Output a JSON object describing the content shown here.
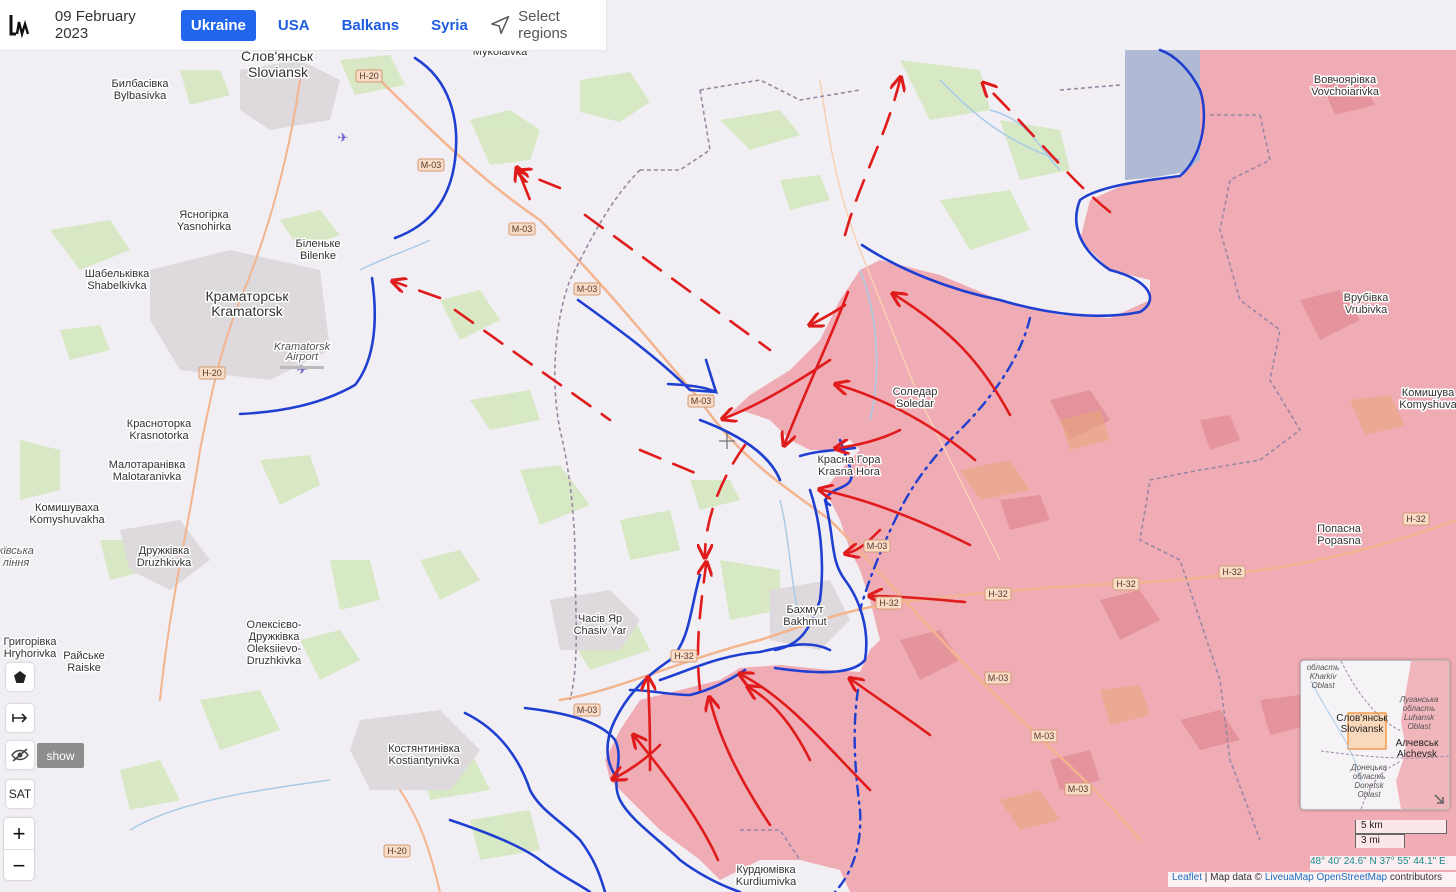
{
  "header": {
    "date": "09 February 2023",
    "tabs": [
      {
        "label": "Ukraine",
        "active": true
      },
      {
        "label": "USA",
        "active": false
      },
      {
        "label": "Balkans",
        "active": false
      },
      {
        "label": "Syria",
        "active": false
      }
    ],
    "select_regions": "Select regions"
  },
  "colors": {
    "occupied": "#f0a6ae",
    "contested": "#a8b4d2",
    "ukraine_arrows": "#1f3fd1",
    "russia_arrows": "#e01b1b",
    "background": "#f2eff4"
  },
  "places": [
    {
      "id": "mykolaivka",
      "text": "Mykolaivka"
    },
    {
      "id": "sloviansk-uk",
      "text": "Слов'янськ"
    },
    {
      "id": "sloviansk",
      "text": "Sloviansk"
    },
    {
      "id": "bylbasivka-uk",
      "text": "Билбасівка"
    },
    {
      "id": "bylbasivka",
      "text": "Bylbasivka"
    },
    {
      "id": "yasnohirka-uk",
      "text": "Ясногірка"
    },
    {
      "id": "yasnohirka",
      "text": "Yasnohirka"
    },
    {
      "id": "bilenke-uk",
      "text": "Біленьке"
    },
    {
      "id": "bilenke",
      "text": "Bilenke"
    },
    {
      "id": "shabelkivka-uk",
      "text": "Шабельківка"
    },
    {
      "id": "shabelkivka",
      "text": "Shabelkivka"
    },
    {
      "id": "kramatorsk-uk",
      "text": "Краматорськ"
    },
    {
      "id": "kramatorsk",
      "text": "Kramatorsk"
    },
    {
      "id": "kramatorsk-airport-1",
      "text": "Kramatorsk"
    },
    {
      "id": "kramatorsk-airport-2",
      "text": "Airport"
    },
    {
      "id": "krasnotorka-uk",
      "text": "Красноторка"
    },
    {
      "id": "krasnotorka",
      "text": "Krasnotorka"
    },
    {
      "id": "malotaranivka-uk",
      "text": "Малотаранівка"
    },
    {
      "id": "malotaranivka",
      "text": "Malotaranivka"
    },
    {
      "id": "komyshuvakha-uk",
      "text": "Комишуваха"
    },
    {
      "id": "komyshuvakha",
      "text": "Komyshuvakha"
    },
    {
      "id": "druzhkivka-uk",
      "text": "Дружківка"
    },
    {
      "id": "druzhkivka",
      "text": "Druzhkivka"
    },
    {
      "id": "oleksiievo-uk",
      "text": "Олексієво-"
    },
    {
      "id": "oleksiievo-uk2",
      "text": "Дружківка"
    },
    {
      "id": "oleksiievo",
      "text": "Oleksiievo-"
    },
    {
      "id": "oleksiievo2",
      "text": "Druzhkivka"
    },
    {
      "id": "hryhorivka-uk",
      "text": "Григорівка"
    },
    {
      "id": "hryhorivka",
      "text": "Hryhorivka"
    },
    {
      "id": "raiske-uk",
      "text": "Райське"
    },
    {
      "id": "raiske",
      "text": "Raiske"
    },
    {
      "id": "kostiantynivka-uk",
      "text": "Костянтинівка"
    },
    {
      "id": "kostiantynivka",
      "text": "Kostiantynivka"
    },
    {
      "id": "chasiv-yar-uk",
      "text": "Часів Яр"
    },
    {
      "id": "chasiv-yar",
      "text": "Chasiv Yar"
    },
    {
      "id": "bakhmut-uk",
      "text": "Бахмут"
    },
    {
      "id": "bakhmut",
      "text": "Bakhmut"
    },
    {
      "id": "krasna-hora-uk",
      "text": "Красна Гора"
    },
    {
      "id": "krasna-hora",
      "text": "Krasna Hora"
    },
    {
      "id": "soledar-uk",
      "text": "Соледар"
    },
    {
      "id": "soledar",
      "text": "Soledar"
    },
    {
      "id": "kurdiumivka-uk",
      "text": "Курдюмівка"
    },
    {
      "id": "kurdiumivka",
      "text": "Kurdiumivka"
    },
    {
      "id": "vovchoiarivka-uk",
      "text": "Вовчоярівка"
    },
    {
      "id": "vovchoiarivka",
      "text": "Vovchoiarivka"
    },
    {
      "id": "vrubivka-uk",
      "text": "Врубівка"
    },
    {
      "id": "vrubivka",
      "text": "Vrubivka"
    },
    {
      "id": "komyshuvakha-e-uk",
      "text": "Комишува"
    },
    {
      "id": "komyshuvakha-e",
      "text": "Komyshuva"
    },
    {
      "id": "popasna-uk",
      "text": "Попасна"
    },
    {
      "id": "popasna",
      "text": "Popasna"
    },
    {
      "id": "oblast-left-uk",
      "text": "кївська"
    },
    {
      "id": "oblast-left",
      "text": "ління"
    }
  ],
  "roads": [
    {
      "id": "h20-a",
      "text": "H-20"
    },
    {
      "id": "m03-a",
      "text": "M-03"
    },
    {
      "id": "m03-b",
      "text": "M-03"
    },
    {
      "id": "m03-c",
      "text": "M-03"
    },
    {
      "id": "m03-d",
      "text": "M-03"
    },
    {
      "id": "h20-b",
      "text": "H-20"
    },
    {
      "id": "m03-e",
      "text": "M-03"
    },
    {
      "id": "h32-a",
      "text": "H-32"
    },
    {
      "id": "h32-b",
      "text": "H-32"
    },
    {
      "id": "h32-c",
      "text": "H-32"
    },
    {
      "id": "h32-d",
      "text": "H-32"
    },
    {
      "id": "h32-e",
      "text": "H-32"
    },
    {
      "id": "h32-f",
      "text": "H-32"
    },
    {
      "id": "m03-f",
      "text": "M-03"
    },
    {
      "id": "m03-g",
      "text": "M-03"
    },
    {
      "id": "m03-h",
      "text": "M-03"
    },
    {
      "id": "m03-i",
      "text": "M-03"
    },
    {
      "id": "h20-c",
      "text": "H-20"
    }
  ],
  "controls": {
    "show": "show",
    "sat": "SAT",
    "zoom_in": "+",
    "zoom_out": "−"
  },
  "minimap": {
    "kharkiv_1": "область",
    "kharkiv_2": "Kharkiv",
    "kharkiv_3": "Oblast",
    "luhansk_1": "Луганська",
    "luhansk_2": "область",
    "luhansk_3": "Luhansk",
    "luhansk_4": "Oblast",
    "sloviansk_uk": "Слов'янськ",
    "sloviansk": "Sloviansk",
    "alchevsk_uk": "Алчевськ",
    "alchevsk": "Alchevsk",
    "donetsk_1": "Донецька",
    "donetsk_2": "область",
    "donetsk_3": "Donetsk",
    "donetsk_4": "Oblast"
  },
  "scale": {
    "km": "5 km",
    "mi": "3 mi"
  },
  "coords": "48° 40' 24.6\" N 37° 55' 44.1\" E",
  "attribution": {
    "leaflet": "Leaflet",
    "sep": " | Map data © ",
    "liveua": "LiveuaMap",
    "osm": "OpenStreetMap",
    "contrib": " contributors"
  }
}
